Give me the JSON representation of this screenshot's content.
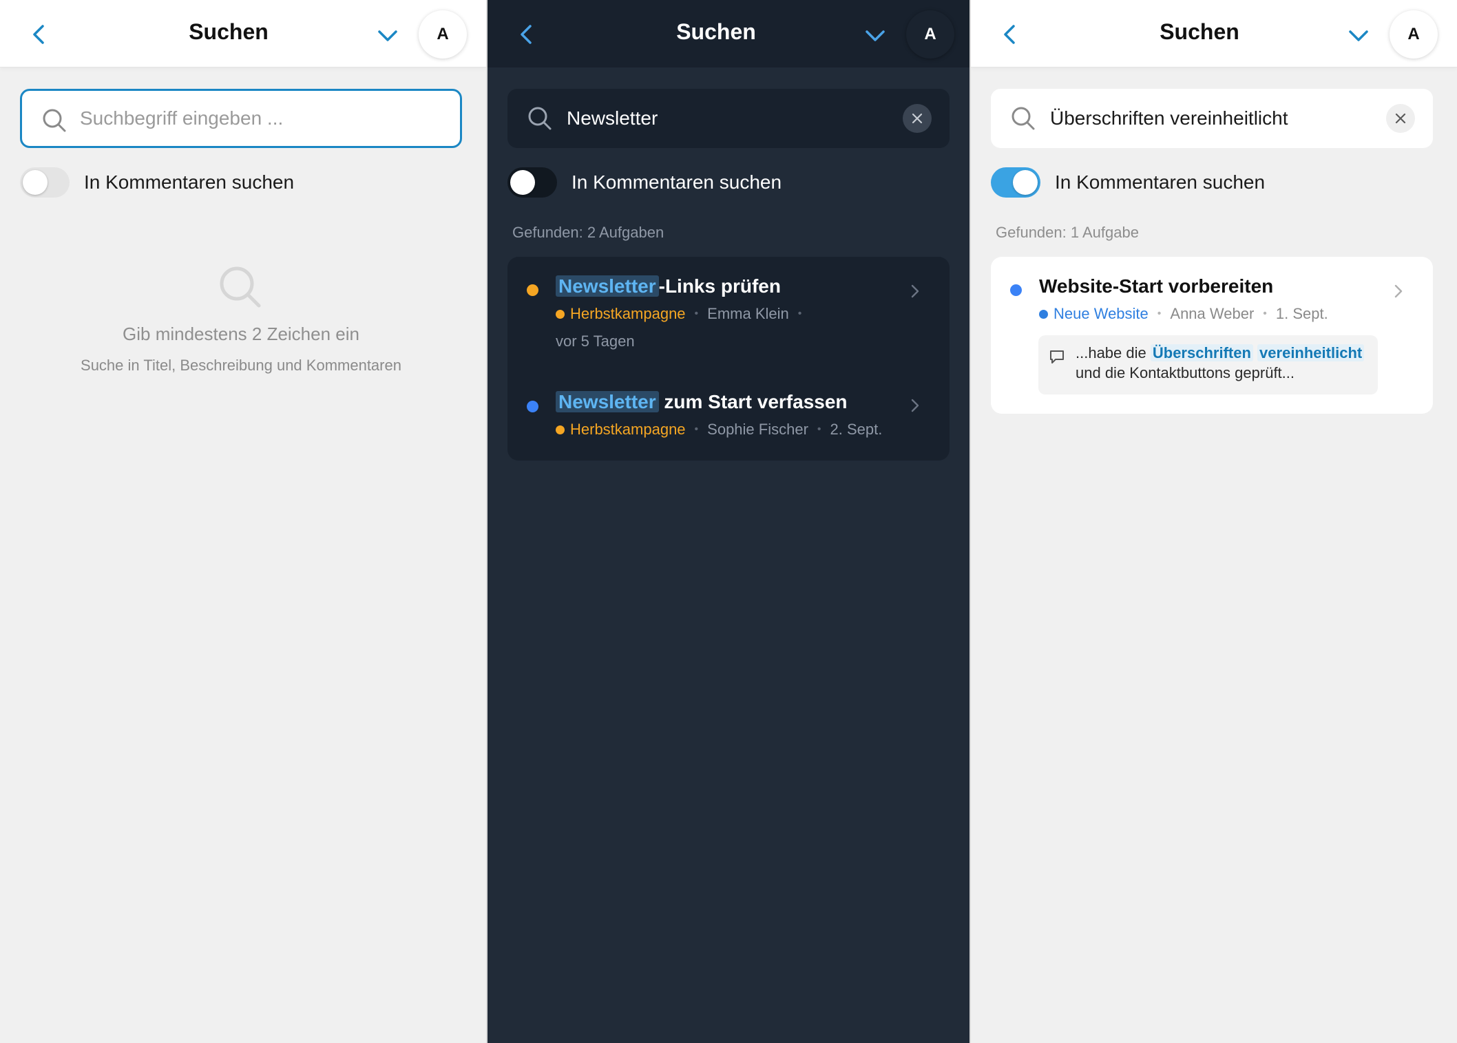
{
  "common": {
    "title": "Suchen",
    "avatar_letter": "A",
    "toggle_label": "In Kommentaren suchen"
  },
  "panel_empty": {
    "search_placeholder": "Suchbegriff eingeben ...",
    "toggle_on": false,
    "empty_title": "Gib mindestens 2 Zeichen ein",
    "empty_subtitle": "Suche in Titel, Beschreibung und Kommentaren"
  },
  "panel_newsletter": {
    "theme": "dark",
    "search_value": "Newsletter",
    "toggle_on": false,
    "found_text": "Gefunden: 2 Aufgaben",
    "results": [
      {
        "title_highlight": "Newsletter",
        "title_rest": "-Links prüfen",
        "status_color": "#f5a623",
        "project": "Herbstkampagne",
        "project_color": "#f5a623",
        "assignee": "Emma Klein",
        "date": "vor 5 Tagen"
      },
      {
        "title_highlight": "Newsletter",
        "title_rest": "zum Start verfassen",
        "status_color": "#3b82f6",
        "project": "Herbstkampagne",
        "project_color": "#f5a623",
        "assignee": "Sophie Fischer",
        "date": "2. Sept."
      }
    ]
  },
  "panel_comments": {
    "search_value": "Überschriften vereinheitlicht",
    "toggle_on": true,
    "found_text": "Gefunden: 1 Aufgabe",
    "results": [
      {
        "title": "Website-Start vorbereiten",
        "status_color": "#3b82f6",
        "project": "Neue Website",
        "project_color": "#2f7fe0",
        "assignee": "Anna Weber",
        "date": "1. Sept.",
        "comment_prefix": "...habe die",
        "comment_match_1": "Überschriften",
        "comment_match_2": "vereinheitlicht",
        "comment_line2": "und die Kontaktbuttons geprüft..."
      }
    ]
  },
  "colors": {
    "accent": "#1b87c4",
    "toggle_on": "#3aa3e3",
    "dark_bg": "#212b38",
    "dark_surface": "#18212d"
  }
}
